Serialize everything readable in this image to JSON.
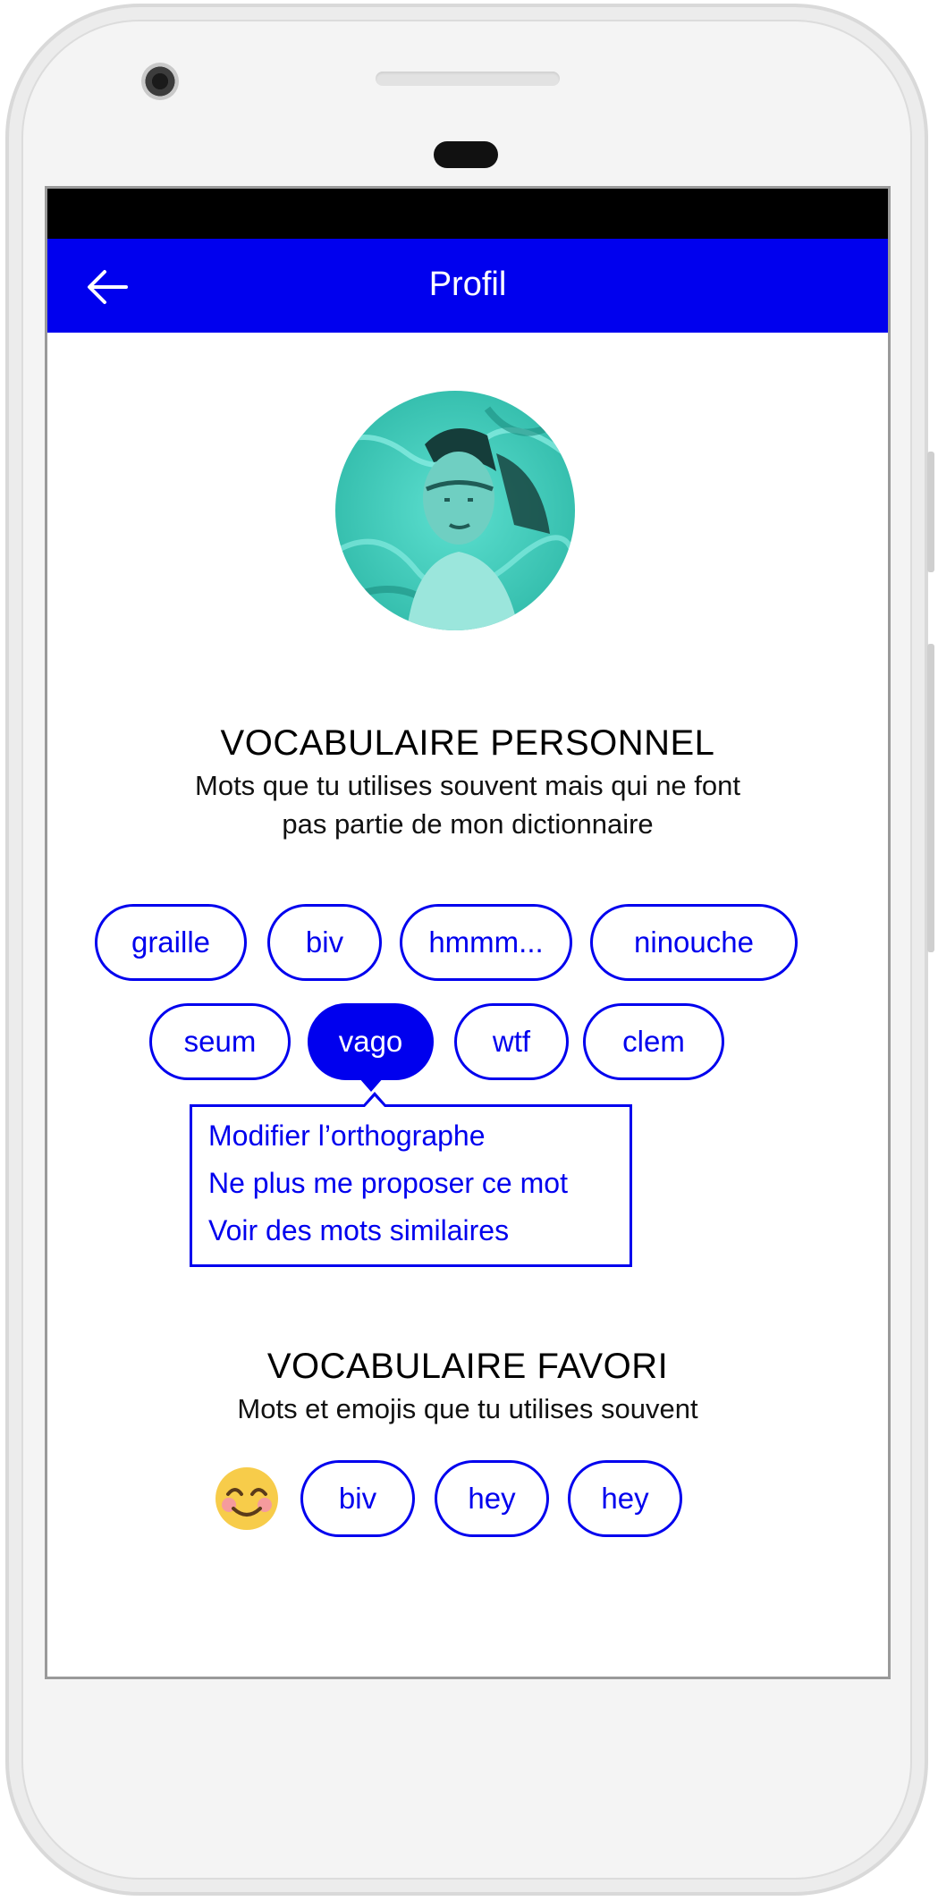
{
  "appbar": {
    "title": "Profil",
    "back_icon": "arrow-left-icon"
  },
  "colors": {
    "accent": "#0000ee",
    "status_bar": "#000000",
    "avatar_tint": "#3ad0c0"
  },
  "personal_vocab": {
    "title": "VOCABULAIRE PERSONNEL",
    "subtitle_line1": "Mots que tu utilises souvent mais qui ne font",
    "subtitle_line2": "pas partie de mon dictionnaire",
    "words": [
      "graille",
      "biv",
      "hmmm...",
      "ninouche",
      "seum",
      "vago",
      "wtf",
      "clem"
    ],
    "selected": "vago"
  },
  "context_menu": {
    "items": [
      "Modifier l’orthographe",
      "Ne plus me proposer ce mot",
      "Voir des mots similaires"
    ]
  },
  "favorite_vocab": {
    "title": "VOCABULAIRE FAVORI",
    "subtitle": "Mots et emojis que tu utilises souvent",
    "emoji_icon": "smiling-face-emoji-icon",
    "words": [
      "biv",
      "hey",
      "hey"
    ]
  }
}
